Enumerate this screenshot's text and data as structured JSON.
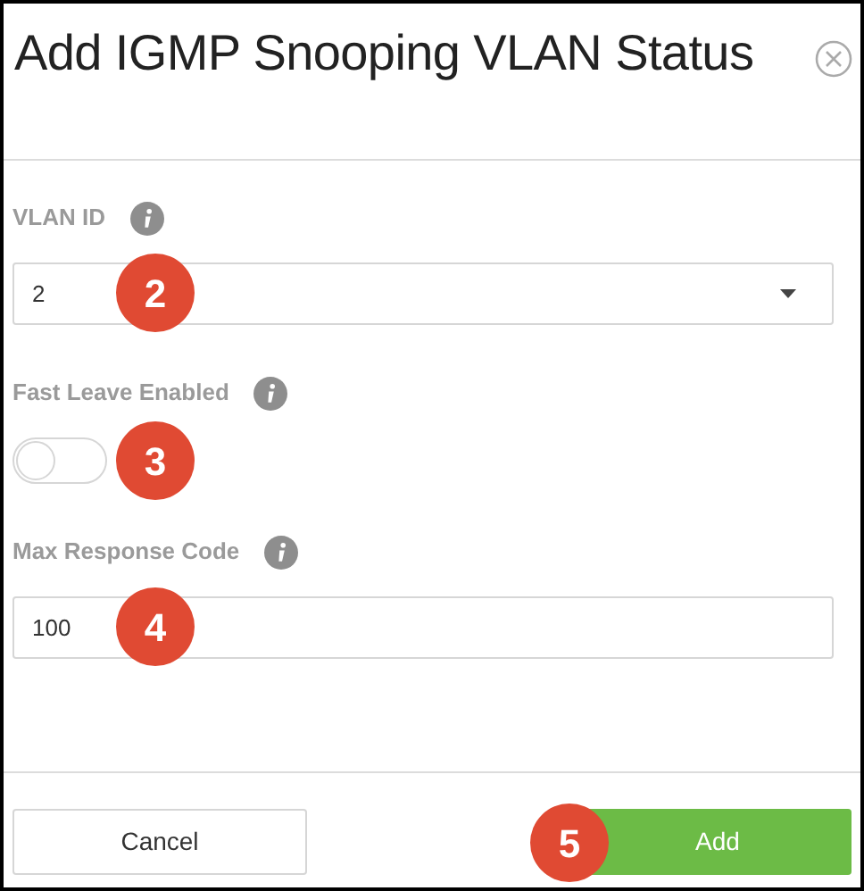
{
  "dialog": {
    "title": "Add IGMP Snooping VLAN Status"
  },
  "fields": [
    {
      "kind": "select",
      "label": "VLAN ID",
      "value": "2",
      "badge": "2"
    },
    {
      "kind": "toggle",
      "label": "Fast Leave Enabled",
      "on": false,
      "badge": "3"
    },
    {
      "kind": "text",
      "label": "Max Response Code",
      "value": "100",
      "badge": "4"
    }
  ],
  "buttons": [
    {
      "kind": "secondary",
      "label": "Cancel"
    },
    {
      "kind": "primary",
      "label": "Add",
      "badge": "5"
    }
  ]
}
